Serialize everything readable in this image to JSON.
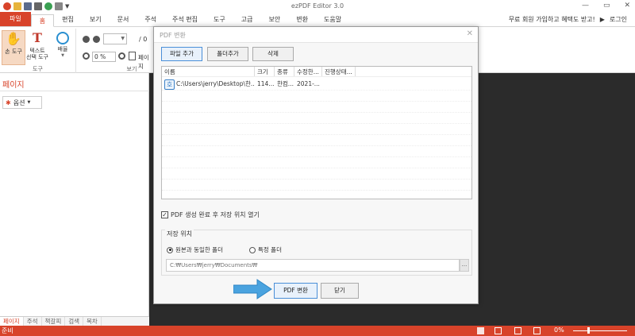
{
  "app": {
    "title": "ezPDF Editor 3.0"
  },
  "window_controls": {
    "minimize": "—",
    "restore": "▭",
    "close": "✕"
  },
  "menu": {
    "tabs": [
      "파일",
      "홈",
      "편집",
      "보기",
      "문서",
      "주석",
      "주석 편집",
      "도구",
      "고급",
      "보안",
      "변환",
      "도움말"
    ],
    "right": {
      "promo": "무료 회원 가입하고 혜택도 받고!",
      "login": "로그인"
    }
  },
  "ribbon": {
    "hand_tool": "손 도구",
    "text_select_line1": "텍스트",
    "text_select_line2": "선택 도구",
    "zoom_line1": "배율",
    "tools_group": "도구",
    "view_group": "보기",
    "page_sep": "/ 0",
    "zoom_value": "0 %",
    "page_label": "페이지"
  },
  "left_panel": {
    "title": "페이지",
    "options": "옵션",
    "tabs": [
      "페이지",
      "주석",
      "책갈피",
      "검색",
      "목차"
    ]
  },
  "status": {
    "text": "준비",
    "zoom": "0%"
  },
  "dialog": {
    "title": "PDF 변환",
    "add_file": "파일 추가",
    "add_folder": "폴더추가",
    "delete": "삭제",
    "columns": [
      "이름",
      "크기",
      "종류",
      "수정한...",
      "진행상태..."
    ],
    "rows": [
      {
        "name": "C:\\Users\\jerry\\Desktop\\한...",
        "size": "114...",
        "type": "한컴...",
        "modified": "2021-...",
        "status": "",
        "icon_char": "호"
      }
    ],
    "open_after": "PDF 생성 완료 후 저장 위치 열기",
    "save_location": "저장 위치",
    "same_folder": "원본과 동일한 폴더",
    "specific_folder": "특정 폴더",
    "path": "C:₩Users₩jerry₩Documents₩",
    "browse": "...",
    "convert": "PDF 변환",
    "close": "닫기"
  },
  "colors": {
    "accent": "#d8432a",
    "dark_bg": "#2b2b2b",
    "arrow": "#4aa3df"
  }
}
